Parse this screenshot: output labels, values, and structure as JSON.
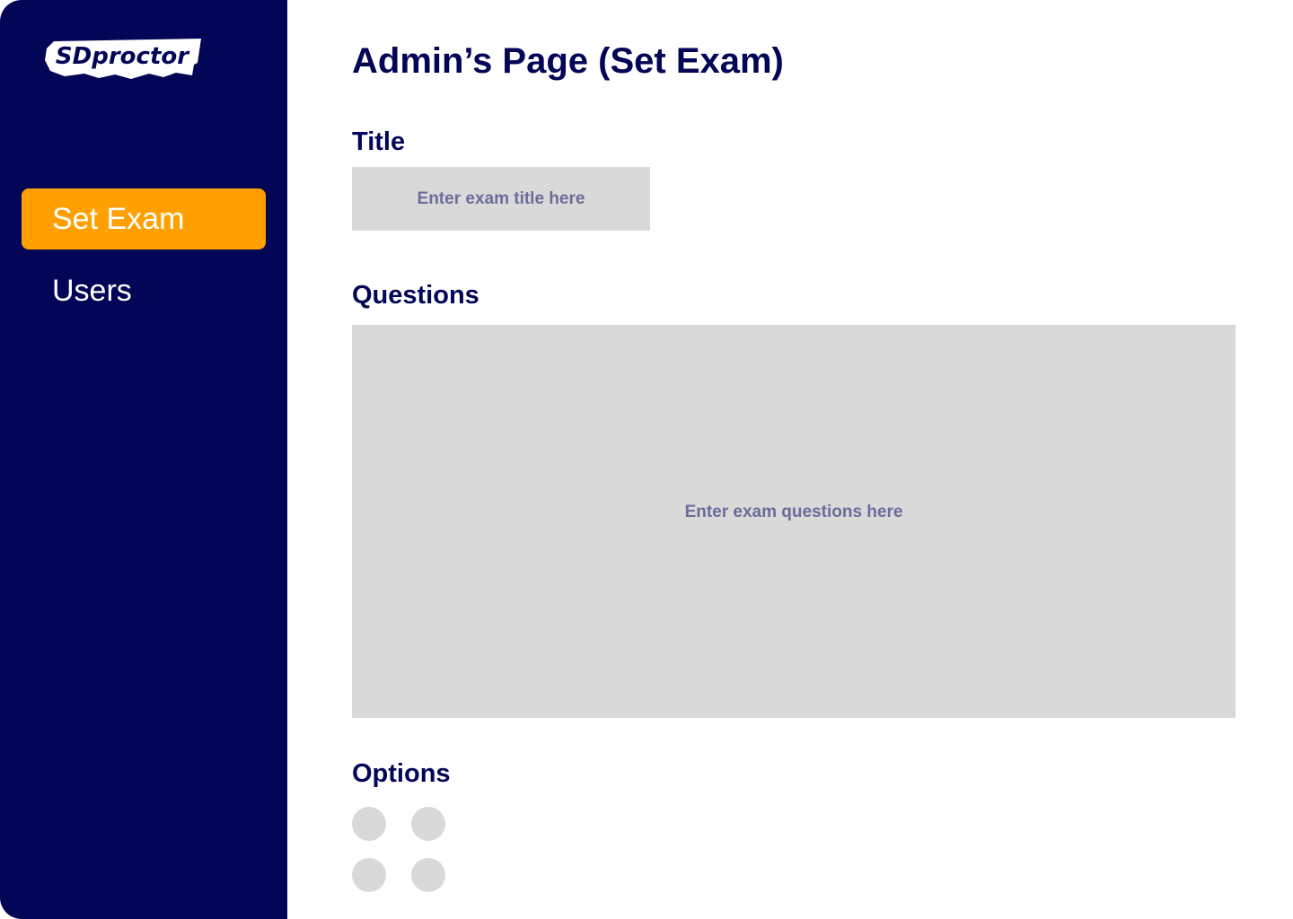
{
  "brand": {
    "logo_text": "SDproctor",
    "colors": {
      "sidebar_bg": "#030556",
      "accent": "#FFA000",
      "field_bg": "#D9D9D9",
      "placeholder_text": "#6A6D9A"
    }
  },
  "sidebar": {
    "items": [
      {
        "label": "Set Exam",
        "active": true
      },
      {
        "label": "Users",
        "active": false
      }
    ]
  },
  "main": {
    "page_title": "Admin’s Page (Set Exam)",
    "title_section": {
      "label": "Title",
      "placeholder": "Enter exam title here"
    },
    "questions_section": {
      "label": "Questions",
      "placeholder": "Enter exam questions here"
    },
    "options_section": {
      "label": "Options",
      "option_count": 4
    }
  }
}
